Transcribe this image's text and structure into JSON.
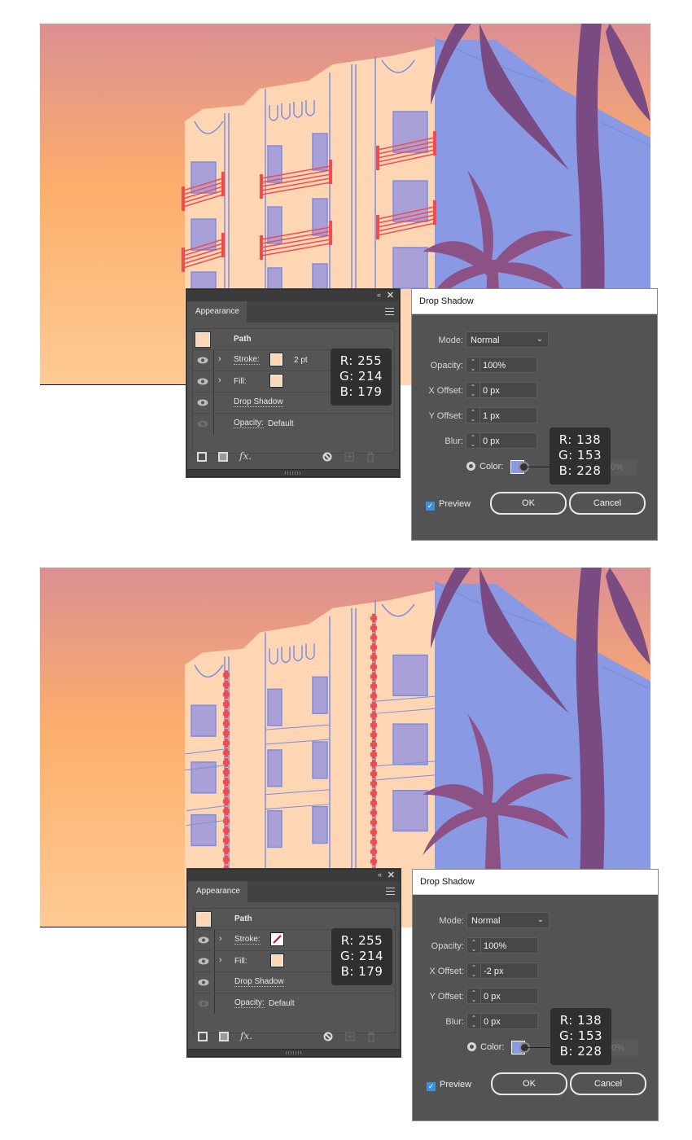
{
  "colors": {
    "sky_top": "#dc8f93",
    "sky_mid": "#fdae6b",
    "sky_bottom": "#ffcb94",
    "facade": "#ffd6b3",
    "shadow_wall": "#8a99e4",
    "trim_blue": "#7b8de0",
    "railing_red": "#f04b50",
    "palm": "#7a4a82",
    "palm_small": "#8c5285",
    "panel_bg": "#535353",
    "dialog_bg": "#535353"
  },
  "steps": [
    {
      "appearance": {
        "tab": "Appearance",
        "path_label": "Path",
        "rows": [
          {
            "label": "Stroke:",
            "swatch": "#ffd6b3",
            "value": "2 pt",
            "expandable": true,
            "visible": true
          },
          {
            "label": "Fill:",
            "swatch": "#ffd6b3",
            "value": "",
            "expandable": true,
            "visible": true
          },
          {
            "label": "Drop Shadow",
            "value": "",
            "expandable": false,
            "visible": true
          },
          {
            "label": "Opacity:",
            "value": "Default",
            "expandable": false,
            "visible": false
          }
        ],
        "tooltip": {
          "r": "R: 255",
          "g": "G: 214",
          "b": "B: 179"
        }
      },
      "dialog": {
        "title": "Drop Shadow",
        "mode_label": "Mode:",
        "mode_value": "Normal",
        "opacity_label": "Opacity:",
        "opacity_value": "100%",
        "x_label": "X Offset:",
        "x_value": "0 px",
        "y_label": "Y Offset:",
        "y_value": "1 px",
        "blur_label": "Blur:",
        "blur_value": "0 px",
        "color_label": "Color:",
        "color_value": "#8a99e4",
        "darkness_value": "0%",
        "preview_label": "Preview",
        "preview_checked": true,
        "ok_label": "OK",
        "cancel_label": "Cancel",
        "tooltip": {
          "r": "R: 138",
          "g": "G: 153",
          "b": "B: 228"
        }
      }
    },
    {
      "appearance": {
        "tab": "Appearance",
        "path_label": "Path",
        "rows": [
          {
            "label": "Stroke:",
            "swatch": "none",
            "value": "",
            "expandable": true,
            "visible": true
          },
          {
            "label": "Fill:",
            "swatch": "#ffd6b3",
            "value": "",
            "expandable": true,
            "visible": true
          },
          {
            "label": "Drop Shadow",
            "value": "",
            "expandable": false,
            "visible": true
          },
          {
            "label": "Opacity:",
            "value": "Default",
            "expandable": false,
            "visible": false
          }
        ],
        "tooltip": {
          "r": "R: 255",
          "g": "G: 214",
          "b": "B: 179"
        }
      },
      "dialog": {
        "title": "Drop Shadow",
        "mode_label": "Mode:",
        "mode_value": "Normal",
        "opacity_label": "Opacity:",
        "opacity_value": "100%",
        "x_label": "X Offset:",
        "x_value": "-2 px",
        "y_label": "Y Offset:",
        "y_value": "0 px",
        "blur_label": "Blur:",
        "blur_value": "0 px",
        "color_label": "Color:",
        "color_value": "#8a99e4",
        "darkness_value": "0%",
        "preview_label": "Preview",
        "preview_checked": true,
        "ok_label": "OK",
        "cancel_label": "Cancel",
        "tooltip": {
          "r": "R: 138",
          "g": "G: 153",
          "b": "B: 228"
        }
      }
    }
  ],
  "icons": {
    "panel_collapse": "«",
    "panel_close": "✕",
    "expand_chevron": "›",
    "fx": "fx.",
    "spinner": "⌃⌄",
    "select_caret": "⌄",
    "checkmark": "✓"
  }
}
